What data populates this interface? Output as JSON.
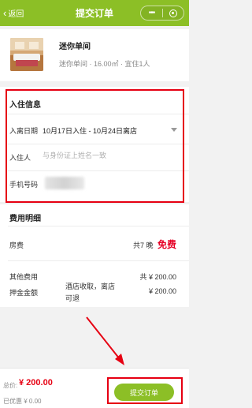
{
  "nav": {
    "back_label": "返回",
    "title": "提交订单",
    "more_icon": "ellipsis-icon",
    "close_icon": "target-icon",
    "color": "#8cbf26"
  },
  "room": {
    "name": "迷你单间",
    "info": "迷你单间 · 16.00㎡ · 宜住1人"
  },
  "guest_info": {
    "section_title": "入住信息",
    "date_label": "入离日期",
    "date_value": "10月17日入住 - 10月24日离店",
    "name_label": "入住人",
    "name_placeholder": "与身份证上姓名一致",
    "name_value": "",
    "phone_label": "手机号码"
  },
  "fees": {
    "section_title": "费用明细",
    "room_label": "房费",
    "room_nights": "共7 晚",
    "room_price": "免费",
    "other_label": "其他费用",
    "other_value": "共 ¥ 200.00",
    "deposit_label": "押金金额",
    "deposit_note": "酒店收取，离店可退",
    "deposit_value": "¥ 200.00"
  },
  "footer": {
    "total_label": "总价:",
    "total_value": "¥ 200.00",
    "discount": "已优惠 ¥ 0.00",
    "submit_label": "提交订单"
  },
  "colors": {
    "accent": "#8cbf26",
    "highlight_red": "#e60012",
    "price_red": "#e60026"
  }
}
